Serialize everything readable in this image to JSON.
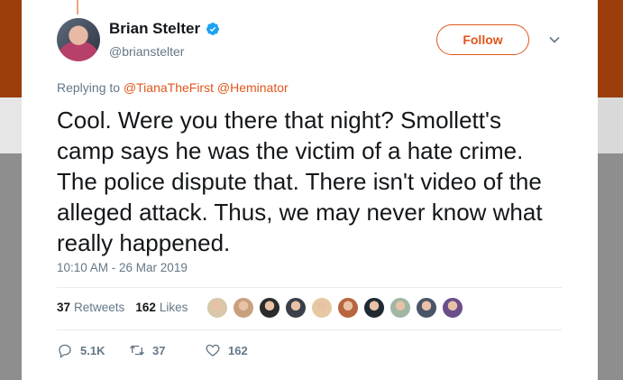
{
  "author": {
    "name": "Brian Stelter",
    "handle": "@brianstelter",
    "verified": true
  },
  "follow_label": "Follow",
  "reply": {
    "prefix": "Replying to",
    "mentions": [
      "@TianaTheFirst",
      "@Heminator"
    ]
  },
  "tweet_text": "Cool. Were you there that night? Smollett's camp says he was the victim of a hate crime. The police dispute that. There isn't video of the alleged attack. Thus, we may never know what really happened.",
  "timestamp": "10:10 AM - 26 Mar 2019",
  "stats": {
    "retweets_count": "37",
    "retweets_label": "Retweets",
    "likes_count": "162",
    "likes_label": "Likes"
  },
  "likers": [
    "#d8c7a8",
    "#c9a07e",
    "#2b2b2b",
    "#3a3f4a",
    "#e6c9a2",
    "#b8653f",
    "#1f2a33",
    "#9fb7a4",
    "#4a5568",
    "#6b4e8a"
  ],
  "actions": {
    "replies": "5.1K",
    "retweets": "37",
    "likes": "162"
  },
  "colors": {
    "accent": "#e0561b",
    "muted": "#657786",
    "verified": "#1da1f2"
  }
}
